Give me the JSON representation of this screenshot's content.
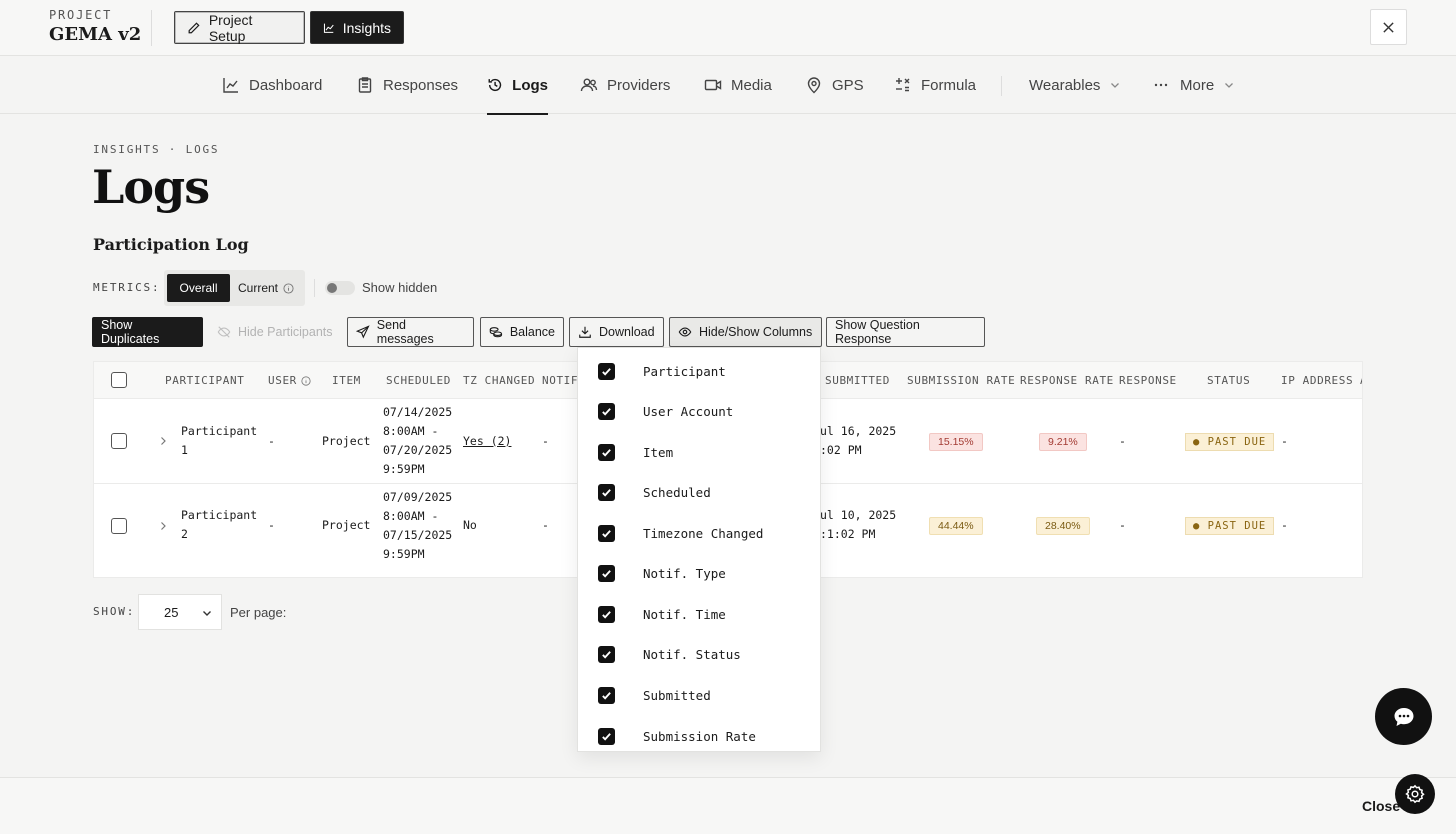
{
  "project": {
    "label": "PROJECT",
    "name": "GEMA v2"
  },
  "topbar": {
    "setup_label": "Project Setup",
    "insights_label": "Insights"
  },
  "nav": {
    "items": [
      {
        "label": "Dashboard",
        "icon": "chart-line-icon"
      },
      {
        "label": "Responses",
        "icon": "clipboard-icon"
      },
      {
        "label": "Logs",
        "icon": "history-icon"
      },
      {
        "label": "Providers",
        "icon": "users-icon"
      },
      {
        "label": "Media",
        "icon": "video-icon"
      },
      {
        "label": "GPS",
        "icon": "map-pin-icon"
      },
      {
        "label": "Formula",
        "icon": "formula-icon"
      },
      {
        "label": "Wearables",
        "icon": "chevron-down-icon"
      },
      {
        "label": "More",
        "icon": "ellipsis-icon"
      }
    ]
  },
  "page": {
    "breadcrumb": "INSIGHTS · LOGS",
    "title": "Logs",
    "subtitle": "Participation Log"
  },
  "metrics": {
    "label": "METRICS:",
    "overall": "Overall",
    "current": "Current",
    "show_hidden": "Show hidden"
  },
  "actions": {
    "show_duplicates": "Show Duplicates",
    "hide_participants": "Hide Participants",
    "send_messages": "Send messages",
    "balance": "Balance",
    "download": "Download",
    "hide_show_columns": "Hide/Show Columns",
    "show_question_response": "Show Question Response"
  },
  "table": {
    "headers": {
      "participant": "PARTICIPANT",
      "user": "USER",
      "item": "ITEM",
      "scheduled": "SCHEDULED",
      "tz_changed": "TZ CHANGED",
      "notif": "NOTIF",
      "submitted": "SUBMITTED",
      "submission_rate": "SUBMISSION RATE",
      "response_rate": "RESPONSE RATE",
      "response": "RESPONSE",
      "status": "STATUS",
      "ip_address": "IP ADDRESS",
      "extra": "A"
    },
    "rows": [
      {
        "participant_l1": "Participant",
        "participant_l2": "1",
        "user": "-",
        "item": "Project",
        "sched_l1": "07/14/2025",
        "sched_l2": "8:00AM -",
        "sched_l3": "07/20/2025",
        "sched_l4": "9:59PM",
        "tz": "Yes (2)",
        "notif": "-",
        "submitted_l1": "ul 16, 2025",
        "submitted_l2": ":02 PM",
        "submission_rate": "15.15%",
        "response_rate": "9.21%",
        "response": "-",
        "status": "PAST DUE",
        "ip": "-"
      },
      {
        "participant_l1": "Participant",
        "participant_l2": "2",
        "user": "-",
        "item": "Project",
        "sched_l1": "07/09/2025",
        "sched_l2": "8:00AM -",
        "sched_l3": "07/15/2025",
        "sched_l4": "9:59PM",
        "tz": "No",
        "notif": "-",
        "submitted_l1": "ul 10, 2025",
        "submitted_l2": ":1:02 PM",
        "submission_rate": "44.44%",
        "response_rate": "28.40%",
        "response": "-",
        "status": "PAST DUE",
        "ip": "-"
      }
    ]
  },
  "pagination": {
    "show_label": "SHOW:",
    "per_page_value": "25",
    "per_page_label": "Per page:"
  },
  "columns_menu": {
    "items": [
      "Participant",
      "User Account",
      "Item",
      "Scheduled",
      "Timezone Changed",
      "Notif. Type",
      "Notif. Time",
      "Notif. Status",
      "Submitted",
      "Submission Rate"
    ]
  },
  "footer": {
    "close_label": "Close"
  },
  "colors": {
    "accent": "#1b1b1b",
    "red_pill": "#fbe3e1",
    "amber_pill": "#fbf0d6"
  }
}
